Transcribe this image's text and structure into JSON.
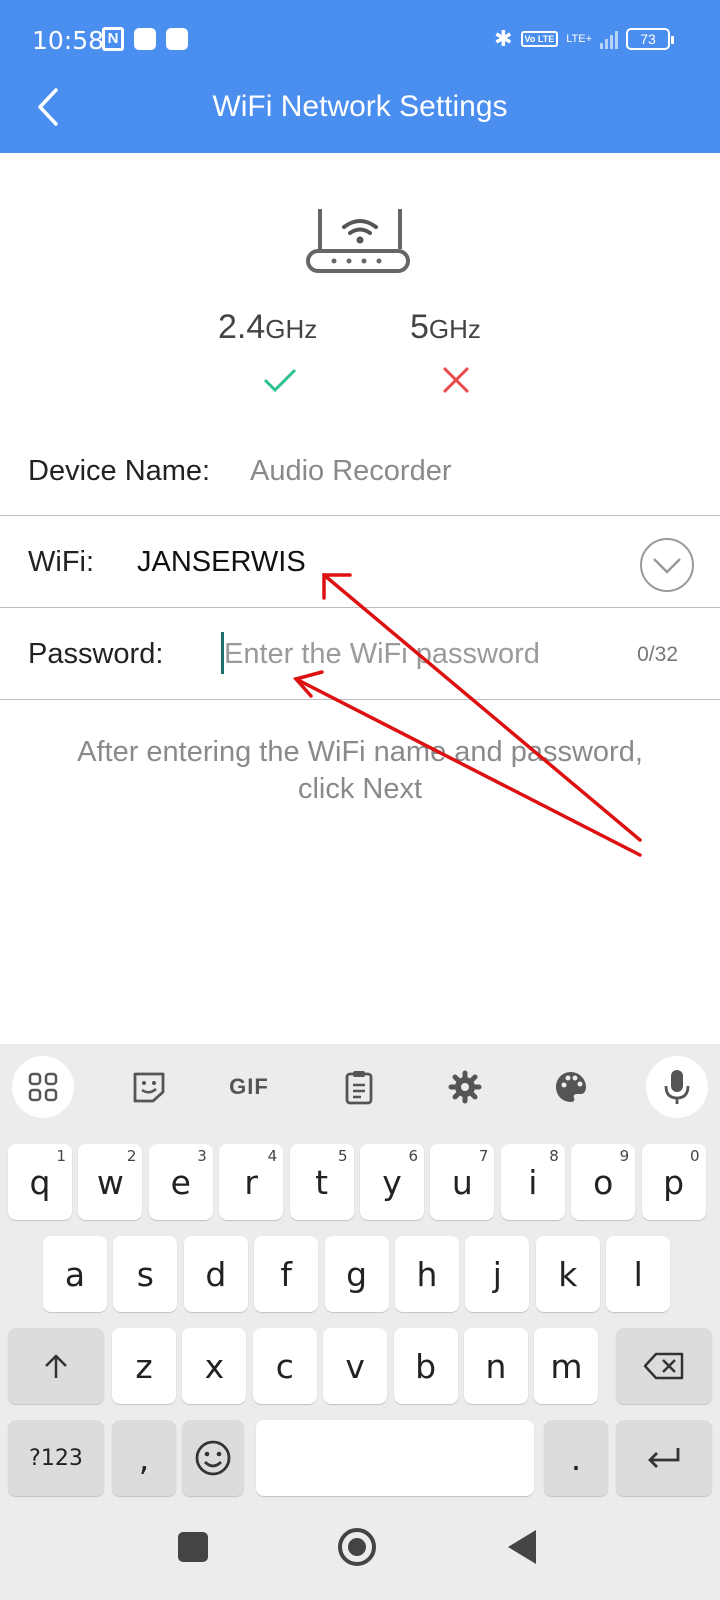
{
  "status_bar": {
    "time": "10:58",
    "nfc": "N",
    "volte": "Vo LTE",
    "network": "LTE+",
    "battery": "73"
  },
  "header": {
    "title": "WiFi Network Settings",
    "back_icon": "chevron-left-icon",
    "background_color": "#4a8ef0"
  },
  "bands": {
    "band_24": {
      "number": "2.4",
      "unit": "GHz",
      "supported": true
    },
    "band_5": {
      "number": "5",
      "unit": "GHz",
      "supported": false
    },
    "check_color": "#2ec08e",
    "cross_color": "#e84a4a"
  },
  "form": {
    "device": {
      "label": "Device Name:",
      "value": "Audio Recorder"
    },
    "wifi": {
      "label": "WiFi:",
      "value": "JANSERWIS"
    },
    "password": {
      "label": "Password:",
      "placeholder": "Enter the WiFi password",
      "value": "",
      "counter": "0/32"
    }
  },
  "hint": {
    "line1": "After entering the WiFi name and password,",
    "line2": "click Next"
  },
  "annotation": {
    "arrow_color": "#dd1111"
  },
  "keyboard": {
    "toolbar": [
      "apps-grid-icon",
      "sticker-icon",
      "GIF",
      "clipboard-icon",
      "settings-gear-icon",
      "palette-icon",
      "microphone-icon"
    ],
    "gif_label": "GIF",
    "row1": [
      {
        "key": "q",
        "num": "1"
      },
      {
        "key": "w",
        "num": "2"
      },
      {
        "key": "e",
        "num": "3"
      },
      {
        "key": "r",
        "num": "4"
      },
      {
        "key": "t",
        "num": "5"
      },
      {
        "key": "y",
        "num": "6"
      },
      {
        "key": "u",
        "num": "7"
      },
      {
        "key": "i",
        "num": "8"
      },
      {
        "key": "o",
        "num": "9"
      },
      {
        "key": "p",
        "num": "0"
      }
    ],
    "row2": [
      "a",
      "s",
      "d",
      "f",
      "g",
      "h",
      "j",
      "k",
      "l"
    ],
    "row3": [
      "z",
      "x",
      "c",
      "v",
      "b",
      "n",
      "m"
    ],
    "symbols_label": "?123",
    "comma": ",",
    "period": "."
  }
}
